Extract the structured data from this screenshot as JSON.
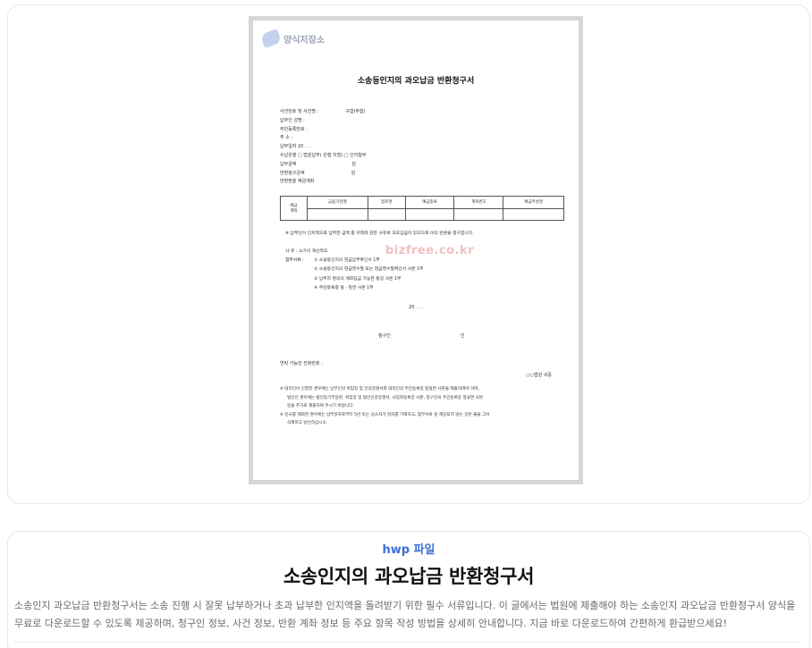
{
  "preview": {
    "watermark_logo": "양식저장소",
    "watermark_url": "bizfree.co.kr",
    "doc_title": "소송등인지의 과오납금 반환청구서",
    "lines": [
      {
        "label": "사건번호 및 사건명 :",
        "fill": "구합(주합)"
      },
      {
        "label": "납부인 성명 :",
        "fill": ""
      },
      {
        "label": "주민등록번호 :",
        "fill": ""
      },
      {
        "label": "주       소 :",
        "fill": ""
      },
      {
        "label": "납부일자      20    .    .    .",
        "fill": ""
      },
      {
        "label": "수납은행    ▢ 법원납부(        은행        지점) ▢ 인지첩부",
        "fill": ""
      },
      {
        "label": "납부금액",
        "fill": "원"
      },
      {
        "label": "반환청구금액",
        "fill": "원"
      },
      {
        "label": "반환받을 예금계좌",
        "fill": ""
      }
    ],
    "account_table": {
      "row_header": "예금\n계좌",
      "columns": [
        "금융기관명",
        "점포명",
        "예금종류",
        "계좌번호",
        "예금주성명"
      ]
    },
    "para1": "※ 납부인이 인지액으로 납부한 금액 중 아래와 같은 사유로 과오납금이 있으므로 이의 반환을 청구합니다.",
    "para2": "사      유 : 소가의 계산착오",
    "attach_label": "첨부서류 :",
    "attachments": [
      "① 소송등인지의 현금납부확인서 1부",
      "② 소송등인지의 현금영수필 또는 현금영수필확인서 사본 1부",
      "③ 납부자 명의의 계좌입금 가능한 통장 사본 1부",
      "④ 주민등록증 앞 · 뒷면 사본 1부"
    ],
    "date_line": "20    .    .    .",
    "applicant_label": "청구인",
    "applicant_seal": "인",
    "contact": "연락 가능한 전화번호 :",
    "court": "○○법원 귀중",
    "notes": [
      "※ 대리인이 신청한 경우에는 납부인의 위임장 및 인감증명서와 대리인의 주민등록증 앞뒷면 사본을 제출하여야 하며,",
      "법인인 경우에는 법인등기부등본, 위임장 및 법인인감증명서, 사업자등록증 사본, 청구인의 주민등록증 앞뒷면 사본",
      "등을 추가로 제출하여 주시기 바랍니다.",
      "※ 민사를 제외한 경우에는 납부일자로부터 5년 또는 상소자가 일자를 기재하고, 첨부서류 중 해당되지 않는 것은 줄을 그어",
      "삭제하고 날인하십시오."
    ]
  },
  "info": {
    "badge": "hwp 파일",
    "title": "소송인지의 과오납금 반환청구서",
    "description": "소송인지 과오납금 반환청구서는 소송 진행 시 잘못 납부하거나 초과 납부한 인지액을 돌려받기 위한 필수 서류입니다. 이 글에서는 법원에 제출해야 하는 소송인지 과오납금 반환청구서 양식을 무료로 다운로드할 수 있도록 제공하며, 청구인 정보, 사건 정보, 반환 계좌 정보 등 주요 항목 작성 방법을 상세히 안내합니다. 지금 바로 다운로드하여 간편하게 환급받으세요!"
  },
  "colors": {
    "accent": "#3b6fd8",
    "card_border": "#e6e8ec",
    "desc_text": "#6b6b6b"
  }
}
